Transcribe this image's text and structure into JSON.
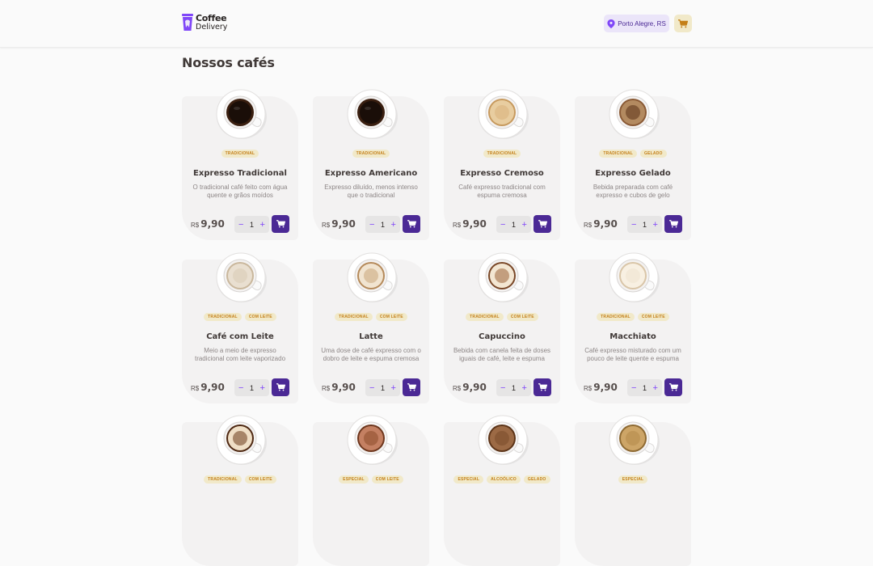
{
  "header": {
    "logo_line1": "Coffee",
    "logo_line2": "Delivery",
    "location": "Porto Alegre, RS",
    "accent": "#4b2995",
    "cart_color": "#c47f17"
  },
  "page_title": "Nossos cafés",
  "coffees": [
    {
      "name": "Expresso Tradicional",
      "desc": "O tradicional café feito com água quente e grãos moídos",
      "tags": [
        "TRADICIONAL"
      ],
      "currency": "R$",
      "price": "9,90",
      "qty": "1",
      "cup": "dark"
    },
    {
      "name": "Expresso Americano",
      "desc": "Expresso diluído, menos intenso que o tradicional",
      "tags": [
        "TRADICIONAL"
      ],
      "currency": "R$",
      "price": "9,90",
      "qty": "1",
      "cup": "dark"
    },
    {
      "name": "Expresso Cremoso",
      "desc": "Café expresso tradicional com espuma cremosa",
      "tags": [
        "TRADICIONAL"
      ],
      "currency": "R$",
      "price": "9,90",
      "qty": "1",
      "cup": "cream"
    },
    {
      "name": "Expresso Gelado",
      "desc": "Bebida preparada com café expresso e cubos de gelo",
      "tags": [
        "TRADICIONAL",
        "GELADO"
      ],
      "currency": "R$",
      "price": "9,90",
      "qty": "1",
      "cup": "iced"
    },
    {
      "name": "Café com Leite",
      "desc": "Meio a meio de expresso tradicional com leite vaporizado",
      "tags": [
        "TRADICIONAL",
        "COM LEITE"
      ],
      "currency": "R$",
      "price": "9,90",
      "qty": "1",
      "cup": "milk"
    },
    {
      "name": "Latte",
      "desc": "Uma dose de café expresso com o dobro de leite e espuma cremosa",
      "tags": [
        "TRADICIONAL",
        "COM LEITE"
      ],
      "currency": "R$",
      "price": "9,90",
      "qty": "1",
      "cup": "latte"
    },
    {
      "name": "Capuccino",
      "desc": "Bebida com canela feita de doses iguais de café, leite e espuma",
      "tags": [
        "TRADICIONAL",
        "COM LEITE"
      ],
      "currency": "R$",
      "price": "9,90",
      "qty": "1",
      "cup": "art"
    },
    {
      "name": "Macchiato",
      "desc": "Café expresso misturado com um pouco de leite quente e espuma",
      "tags": [
        "TRADICIONAL",
        "COM LEITE"
      ],
      "currency": "R$",
      "price": "9,90",
      "qty": "1",
      "cup": "macchiato"
    },
    {
      "name": "",
      "desc": "",
      "tags": [
        "TRADICIONAL",
        "COM LEITE"
      ],
      "currency": "",
      "price": "",
      "qty": "",
      "cup": "mocha"
    },
    {
      "name": "",
      "desc": "",
      "tags": [
        "ESPECIAL",
        "COM LEITE"
      ],
      "currency": "",
      "price": "",
      "qty": "",
      "cup": "choco"
    },
    {
      "name": "",
      "desc": "",
      "tags": [
        "ESPECIAL",
        "ALCOÓLICO",
        "GELADO"
      ],
      "currency": "",
      "price": "",
      "qty": "",
      "cup": "cubano"
    },
    {
      "name": "",
      "desc": "",
      "tags": [
        "ESPECIAL"
      ],
      "currency": "",
      "price": "",
      "qty": "",
      "cup": "havaiano"
    }
  ]
}
